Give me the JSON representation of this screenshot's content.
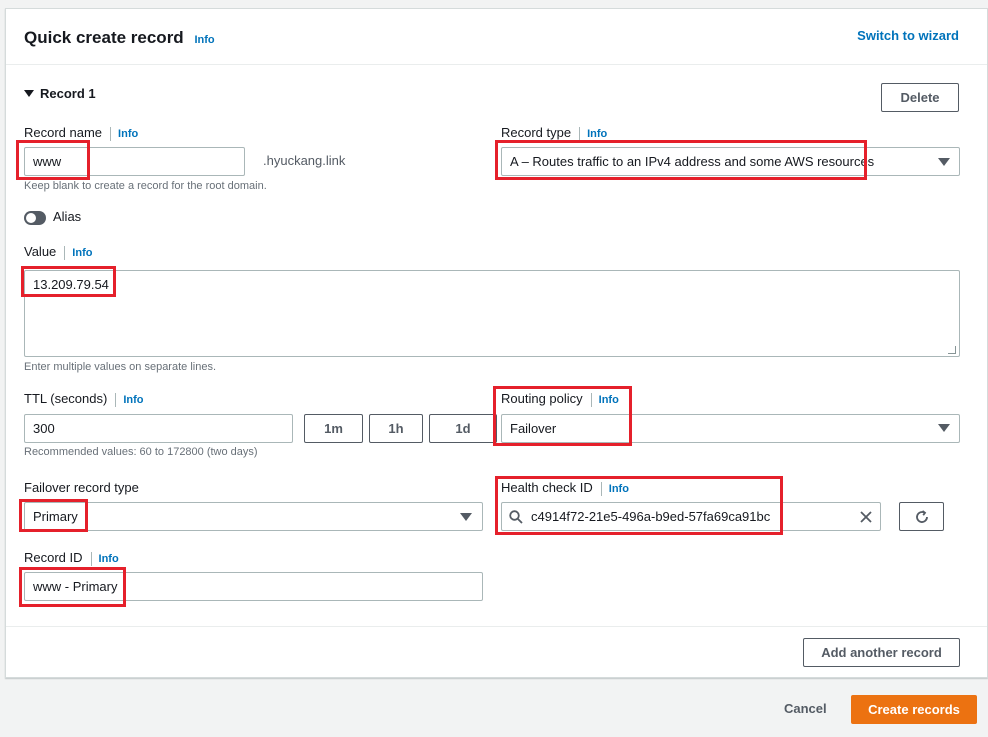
{
  "header": {
    "title": "Quick create record",
    "info": "Info",
    "switch_link": "Switch to wizard"
  },
  "record": {
    "section_label": "Record 1",
    "delete_label": "Delete",
    "name": {
      "label": "Record name",
      "info": "Info",
      "value": "www",
      "suffix": ".hyuckang.link",
      "hint": "Keep blank to create a record for the root domain."
    },
    "type": {
      "label": "Record type",
      "info": "Info",
      "value": "A – Routes traffic to an IPv4 address and some AWS resources"
    },
    "alias": {
      "label": "Alias",
      "enabled": false
    },
    "value": {
      "label": "Value",
      "info": "Info",
      "text": "13.209.79.54",
      "hint": "Enter multiple values on separate lines."
    },
    "ttl": {
      "label": "TTL (seconds)",
      "info": "Info",
      "value": "300",
      "presets": [
        "1m",
        "1h",
        "1d"
      ],
      "hint": "Recommended values: 60 to 172800 (two days)"
    },
    "routing": {
      "label": "Routing policy",
      "info": "Info",
      "value": "Failover"
    },
    "failover_type": {
      "label": "Failover record type",
      "value": "Primary"
    },
    "health_check": {
      "label": "Health check ID",
      "info": "Info",
      "value": "c4914f72-21e5-496a-b9ed-57fa69ca91bc"
    },
    "record_id": {
      "label": "Record ID",
      "info": "Info",
      "value": "www - Primary"
    }
  },
  "footer": {
    "add_another": "Add another record",
    "cancel": "Cancel",
    "create": "Create records"
  },
  "colors": {
    "accent_link": "#0073bb",
    "primary_button": "#ec7211",
    "highlight_box": "#e5202b"
  }
}
